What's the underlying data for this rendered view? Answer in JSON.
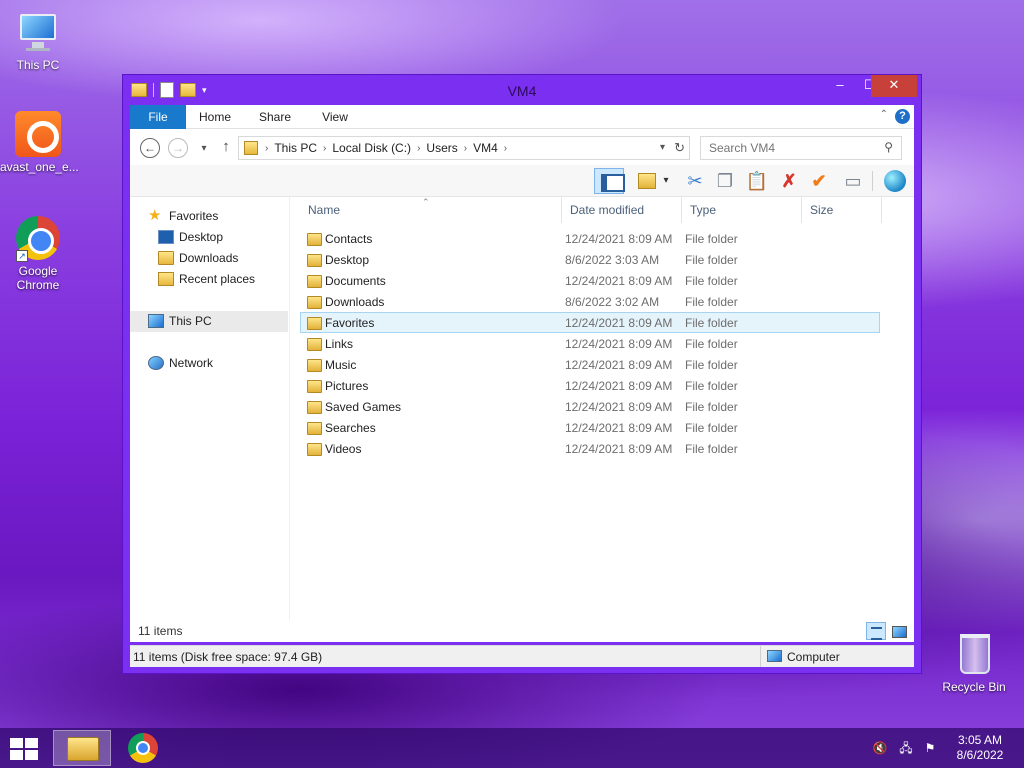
{
  "desktop": {
    "icons": [
      {
        "label": "This PC"
      },
      {
        "label": "avast_one_e..."
      },
      {
        "label": "Google Chrome"
      },
      {
        "label": "Recycle Bin"
      }
    ]
  },
  "window": {
    "title": "VM4",
    "controls": {
      "minimize": "–",
      "maximize": "☐",
      "close": "✕"
    }
  },
  "ribbon": {
    "tabs": [
      "File",
      "Home",
      "Share",
      "View"
    ],
    "collapse": "⌃",
    "help": "?"
  },
  "navigation": {
    "back": "←",
    "forward": "→",
    "recent": "▾",
    "up": "↑",
    "breadcrumb": [
      "This PC",
      "Local Disk (C:)",
      "Users",
      "VM4"
    ],
    "search_placeholder": "Search VM4"
  },
  "nav_pane": {
    "favorites": "Favorites",
    "favorites_items": [
      "Desktop",
      "Downloads",
      "Recent places"
    ],
    "this_pc": "This PC",
    "network": "Network"
  },
  "columns": [
    "Name",
    "Date modified",
    "Type",
    "Size"
  ],
  "files": [
    {
      "name": "Contacts",
      "date": "12/24/2021 8:09 AM",
      "type": "File folder"
    },
    {
      "name": "Desktop",
      "date": "8/6/2022 3:03 AM",
      "type": "File folder"
    },
    {
      "name": "Documents",
      "date": "12/24/2021 8:09 AM",
      "type": "File folder"
    },
    {
      "name": "Downloads",
      "date": "8/6/2022 3:02 AM",
      "type": "File folder"
    },
    {
      "name": "Favorites",
      "date": "12/24/2021 8:09 AM",
      "type": "File folder",
      "selected": true
    },
    {
      "name": "Links",
      "date": "12/24/2021 8:09 AM",
      "type": "File folder"
    },
    {
      "name": "Music",
      "date": "12/24/2021 8:09 AM",
      "type": "File folder"
    },
    {
      "name": "Pictures",
      "date": "12/24/2021 8:09 AM",
      "type": "File folder"
    },
    {
      "name": "Saved Games",
      "date": "12/24/2021 8:09 AM",
      "type": "File folder"
    },
    {
      "name": "Searches",
      "date": "12/24/2021 8:09 AM",
      "type": "File folder"
    },
    {
      "name": "Videos",
      "date": "12/24/2021 8:09 AM",
      "type": "File folder"
    }
  ],
  "status": {
    "item_count": "11 items",
    "disk_info": "11 items (Disk free space: 97.4 GB)",
    "location": "Computer"
  },
  "taskbar": {
    "time": "3:05 AM",
    "date": "8/6/2022"
  },
  "colors": {
    "accent": "#1979ca",
    "window_border": "#7b2ff0",
    "selection": "#e5f3fb",
    "close_button": "#c7413a"
  }
}
